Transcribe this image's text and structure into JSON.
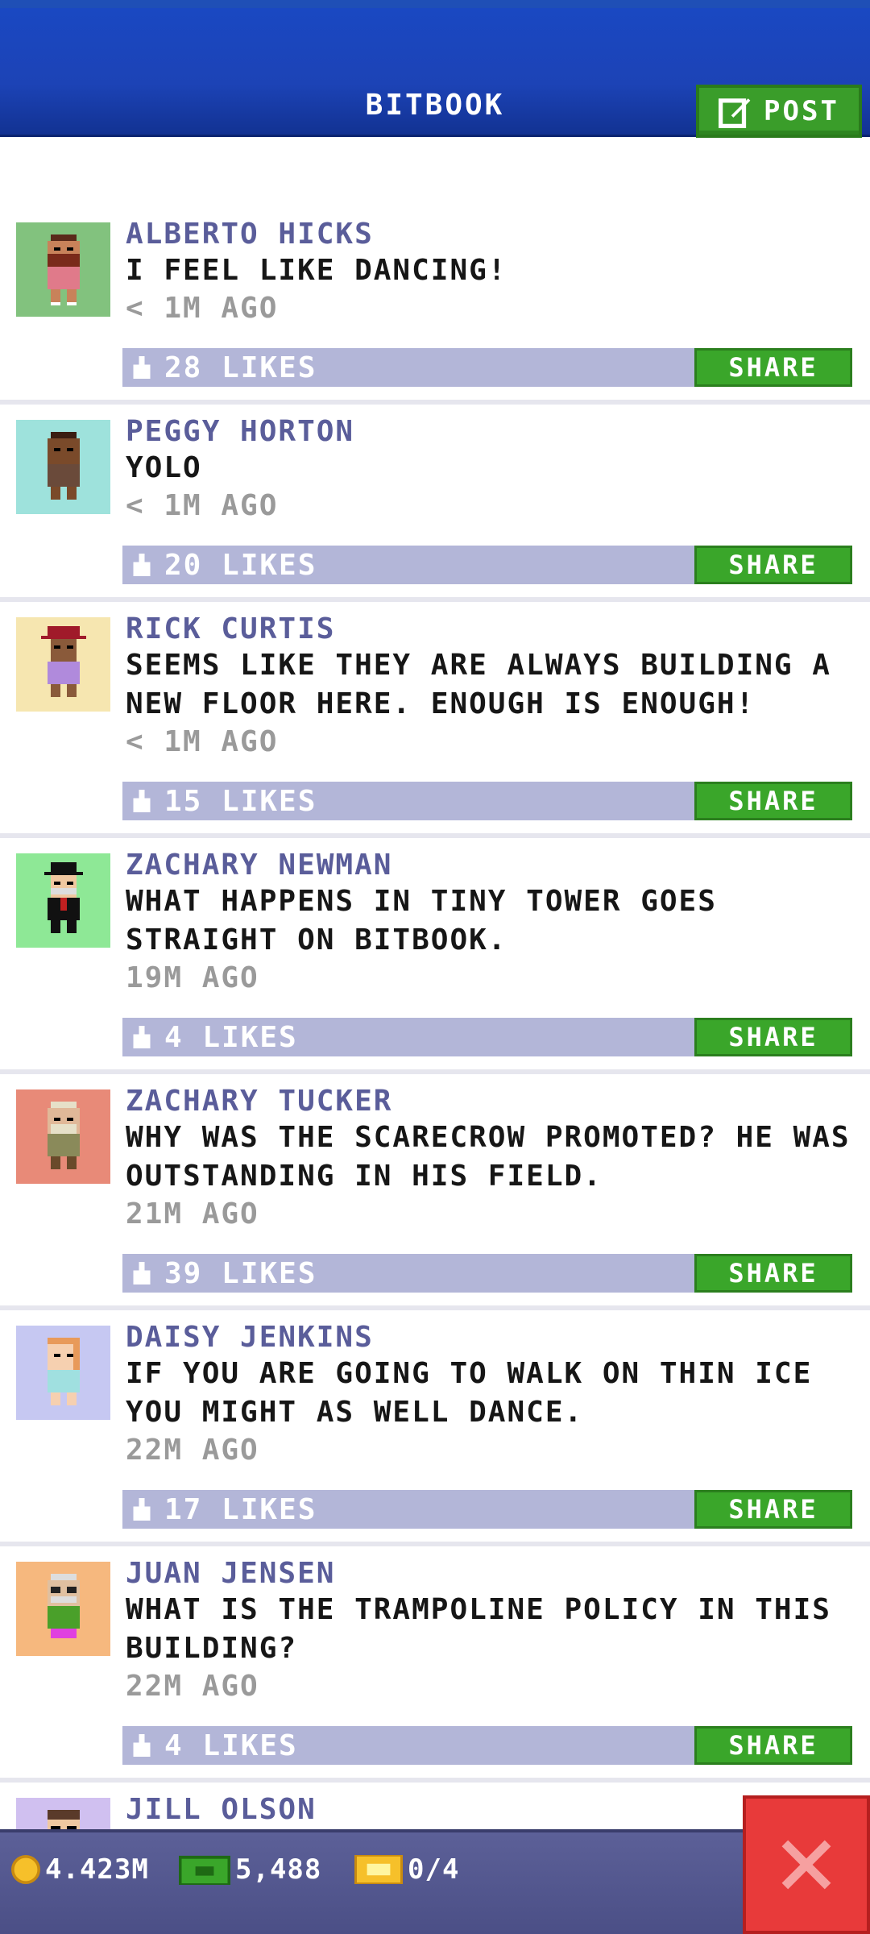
{
  "header": {
    "title": "BITBOOK",
    "post_label": "POST"
  },
  "posts": [
    {
      "name": "ALBERTO HICKS",
      "message": "I FEEL LIKE DANCING!",
      "time": "< 1M AGO",
      "likes": "28 LIKES",
      "share_label": "SHARE",
      "avatar_bg": "#82c27e"
    },
    {
      "name": "PEGGY HORTON",
      "message": "YOLO",
      "time": "< 1M AGO",
      "likes": "20 LIKES",
      "share_label": "SHARE",
      "avatar_bg": "#9ee2dc"
    },
    {
      "name": "RICK CURTIS",
      "message": "SEEMS LIKE THEY ARE ALWAYS BUILDING A NEW FLOOR HERE. ENOUGH IS ENOUGH!",
      "time": "< 1M AGO",
      "likes": "15 LIKES",
      "share_label": "SHARE",
      "avatar_bg": "#f6e6b0"
    },
    {
      "name": "ZACHARY NEWMAN",
      "message": "WHAT HAPPENS IN TINY TOWER GOES STRAIGHT ON BITBOOK.",
      "time": "19M AGO",
      "likes": "4 LIKES",
      "share_label": "SHARE",
      "avatar_bg": "#8ee896"
    },
    {
      "name": "ZACHARY TUCKER",
      "message": "WHY WAS THE SCARECROW PROMOTED? HE WAS OUTSTANDING IN HIS FIELD.",
      "time": "21M AGO",
      "likes": "39 LIKES",
      "share_label": "SHARE",
      "avatar_bg": "#e88a78"
    },
    {
      "name": "DAISY JENKINS",
      "message": "IF YOU ARE GOING TO WALK ON THIN ICE YOU MIGHT AS WELL DANCE.",
      "time": "22M AGO",
      "likes": "17 LIKES",
      "share_label": "SHARE",
      "avatar_bg": "#c6c8f2"
    },
    {
      "name": "JUAN JENSEN",
      "message": "WHAT IS THE TRAMPOLINE POLICY IN THIS BUILDING?",
      "time": "22M AGO",
      "likes": "4 LIKES",
      "share_label": "SHARE",
      "avatar_bg": "#f6b87e"
    },
    {
      "name": "JILL OLSON",
      "message": "",
      "time": "",
      "likes": "",
      "share_label": "",
      "avatar_bg": "#d0c0f0"
    }
  ],
  "status": {
    "coins": "4.423M",
    "bux": "5,488",
    "tickets": "0/4"
  },
  "colors": {
    "header_blue": "#1a48c2",
    "share_green": "#3aa62a",
    "like_bar": "#b3b6d8",
    "close_red": "#e83a3a"
  }
}
